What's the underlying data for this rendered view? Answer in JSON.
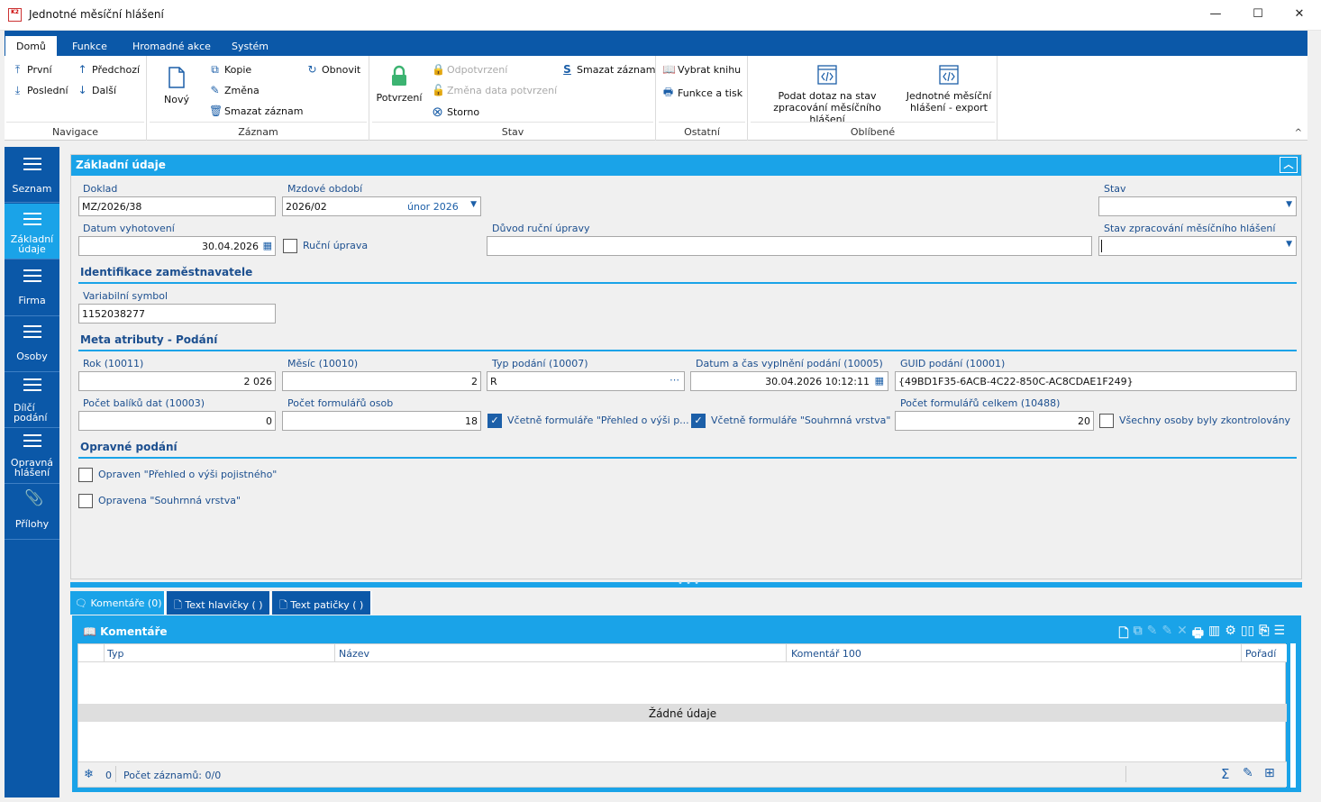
{
  "window": {
    "icon_text": "K2",
    "title": "Jednotné měsíční hlášení",
    "minimize": "—",
    "maximize": "☐",
    "close": "✕"
  },
  "menu": {
    "tabs": [
      "Domů",
      "Funkce",
      "Hromadné akce",
      "Systém"
    ]
  },
  "ribbon": {
    "navigace": {
      "label": "Navigace",
      "first": "První",
      "last": "Poslední",
      "prev": "Předchozí",
      "next": "Další"
    },
    "zaznam": {
      "label": "Záznam",
      "new": "Nový",
      "copy": "Kopie",
      "change": "Změna",
      "delete": "Smazat záznam",
      "refresh": "Obnovit"
    },
    "stav": {
      "label": "Stav",
      "confirm": "Potvrzení",
      "unconfirm": "Odpotvrzení",
      "change_date": "Změna data potvrzení",
      "storno": "Storno",
      "delete": "Smazat záznam"
    },
    "ostatni": {
      "label": "Ostatní",
      "select_book": "Vybrat knihu",
      "functions_print": "Funkce a tisk"
    },
    "oblibene": {
      "label": "Oblíbené",
      "query_line1": "Podat dotaz na stav",
      "query_line2": "zpracování měsíčního hlášení",
      "export_line1": "Jednotné měsíční",
      "export_line2": "hlášení - export"
    },
    "collapse": "^"
  },
  "sidebar": {
    "items": [
      {
        "label1": "Seznam",
        "label2": ""
      },
      {
        "label1": "Základní",
        "label2": "údaje"
      },
      {
        "label1": "Firma",
        "label2": ""
      },
      {
        "label1": "Osoby",
        "label2": ""
      },
      {
        "label1": "Dílčí",
        "label2": "podání"
      },
      {
        "label1": "Opravná",
        "label2": "hlášení"
      },
      {
        "label1": "Přílohy",
        "label2": ""
      }
    ]
  },
  "form": {
    "section_title": "Základní údaje",
    "doklad": {
      "label": "Doklad",
      "value": "MZ/2026/38"
    },
    "mzdove_obdobi": {
      "label": "Mzdové období",
      "value": "2026/02",
      "display": "únor 2026"
    },
    "stav": {
      "label": "Stav",
      "value": ""
    },
    "datum_vyhotoveni": {
      "label": "Datum vyhotovení",
      "value": "30.04.2026"
    },
    "rucni_uprava": {
      "label": "Ruční úprava",
      "checked": false
    },
    "duvod": {
      "label": "Důvod ruční úpravy",
      "value": ""
    },
    "stav_zpracovani": {
      "label": "Stav zpracování měsíčního hlášení",
      "value": ""
    },
    "identifikace_title": "Identifikace zaměstnavatele",
    "variabilni_symbol": {
      "label": "Variabilní symbol",
      "value": "1152038277"
    },
    "meta_title": "Meta atributy - Podání",
    "rok": {
      "label": "Rok (10011)",
      "value": "2 026"
    },
    "mesic": {
      "label": "Měsíc (10010)",
      "value": "2"
    },
    "typ_podani": {
      "label": "Typ podání (10007)",
      "value": "R"
    },
    "datum_cas": {
      "label": "Datum a čas vyplnění podání (10005)",
      "value": "30.04.2026 10:12:11"
    },
    "guid": {
      "label": "GUID podání (10001)",
      "value": "{49BD1F35-6ACB-4C22-850C-AC8CDAE1F249}"
    },
    "pocet_baliku": {
      "label": "Počet balíků dat (10003)",
      "value": "0"
    },
    "pocet_formularu": {
      "label": "Počet formulářů osob",
      "value": "18"
    },
    "vcetne_prehled": {
      "label": "Včetně formuláře \"Přehled o výši p...",
      "checked": true
    },
    "vcetne_souhrnna": {
      "label": "Včetně formuláře \"Souhrnná vrstva\"",
      "checked": true
    },
    "pocet_celkem": {
      "label": "Počet formulářů celkem (10488)",
      "value": "20"
    },
    "vsechny_osoby": {
      "label": "Všechny osoby byly zkontrolovány",
      "checked": false
    },
    "opravne_title": "Opravné podání",
    "opraven_prehled": {
      "label": "Opraven \"Přehled o výši pojistného\"",
      "checked": false
    },
    "opravena_souhrnna": {
      "label": "Opravena \"Souhrnná vrstva\"",
      "checked": false
    }
  },
  "bottom_tabs": [
    "Komentáře (0)",
    "Text hlavičky ( )",
    "Text patičky ( )"
  ],
  "comments": {
    "title": "Komentáře",
    "columns": [
      "Typ",
      "Název",
      "Komentář 100",
      "Pořadí"
    ],
    "empty_text": "Žádné údaje",
    "footer_count": "0",
    "footer_records": "Počet záznamů: 0/0"
  }
}
